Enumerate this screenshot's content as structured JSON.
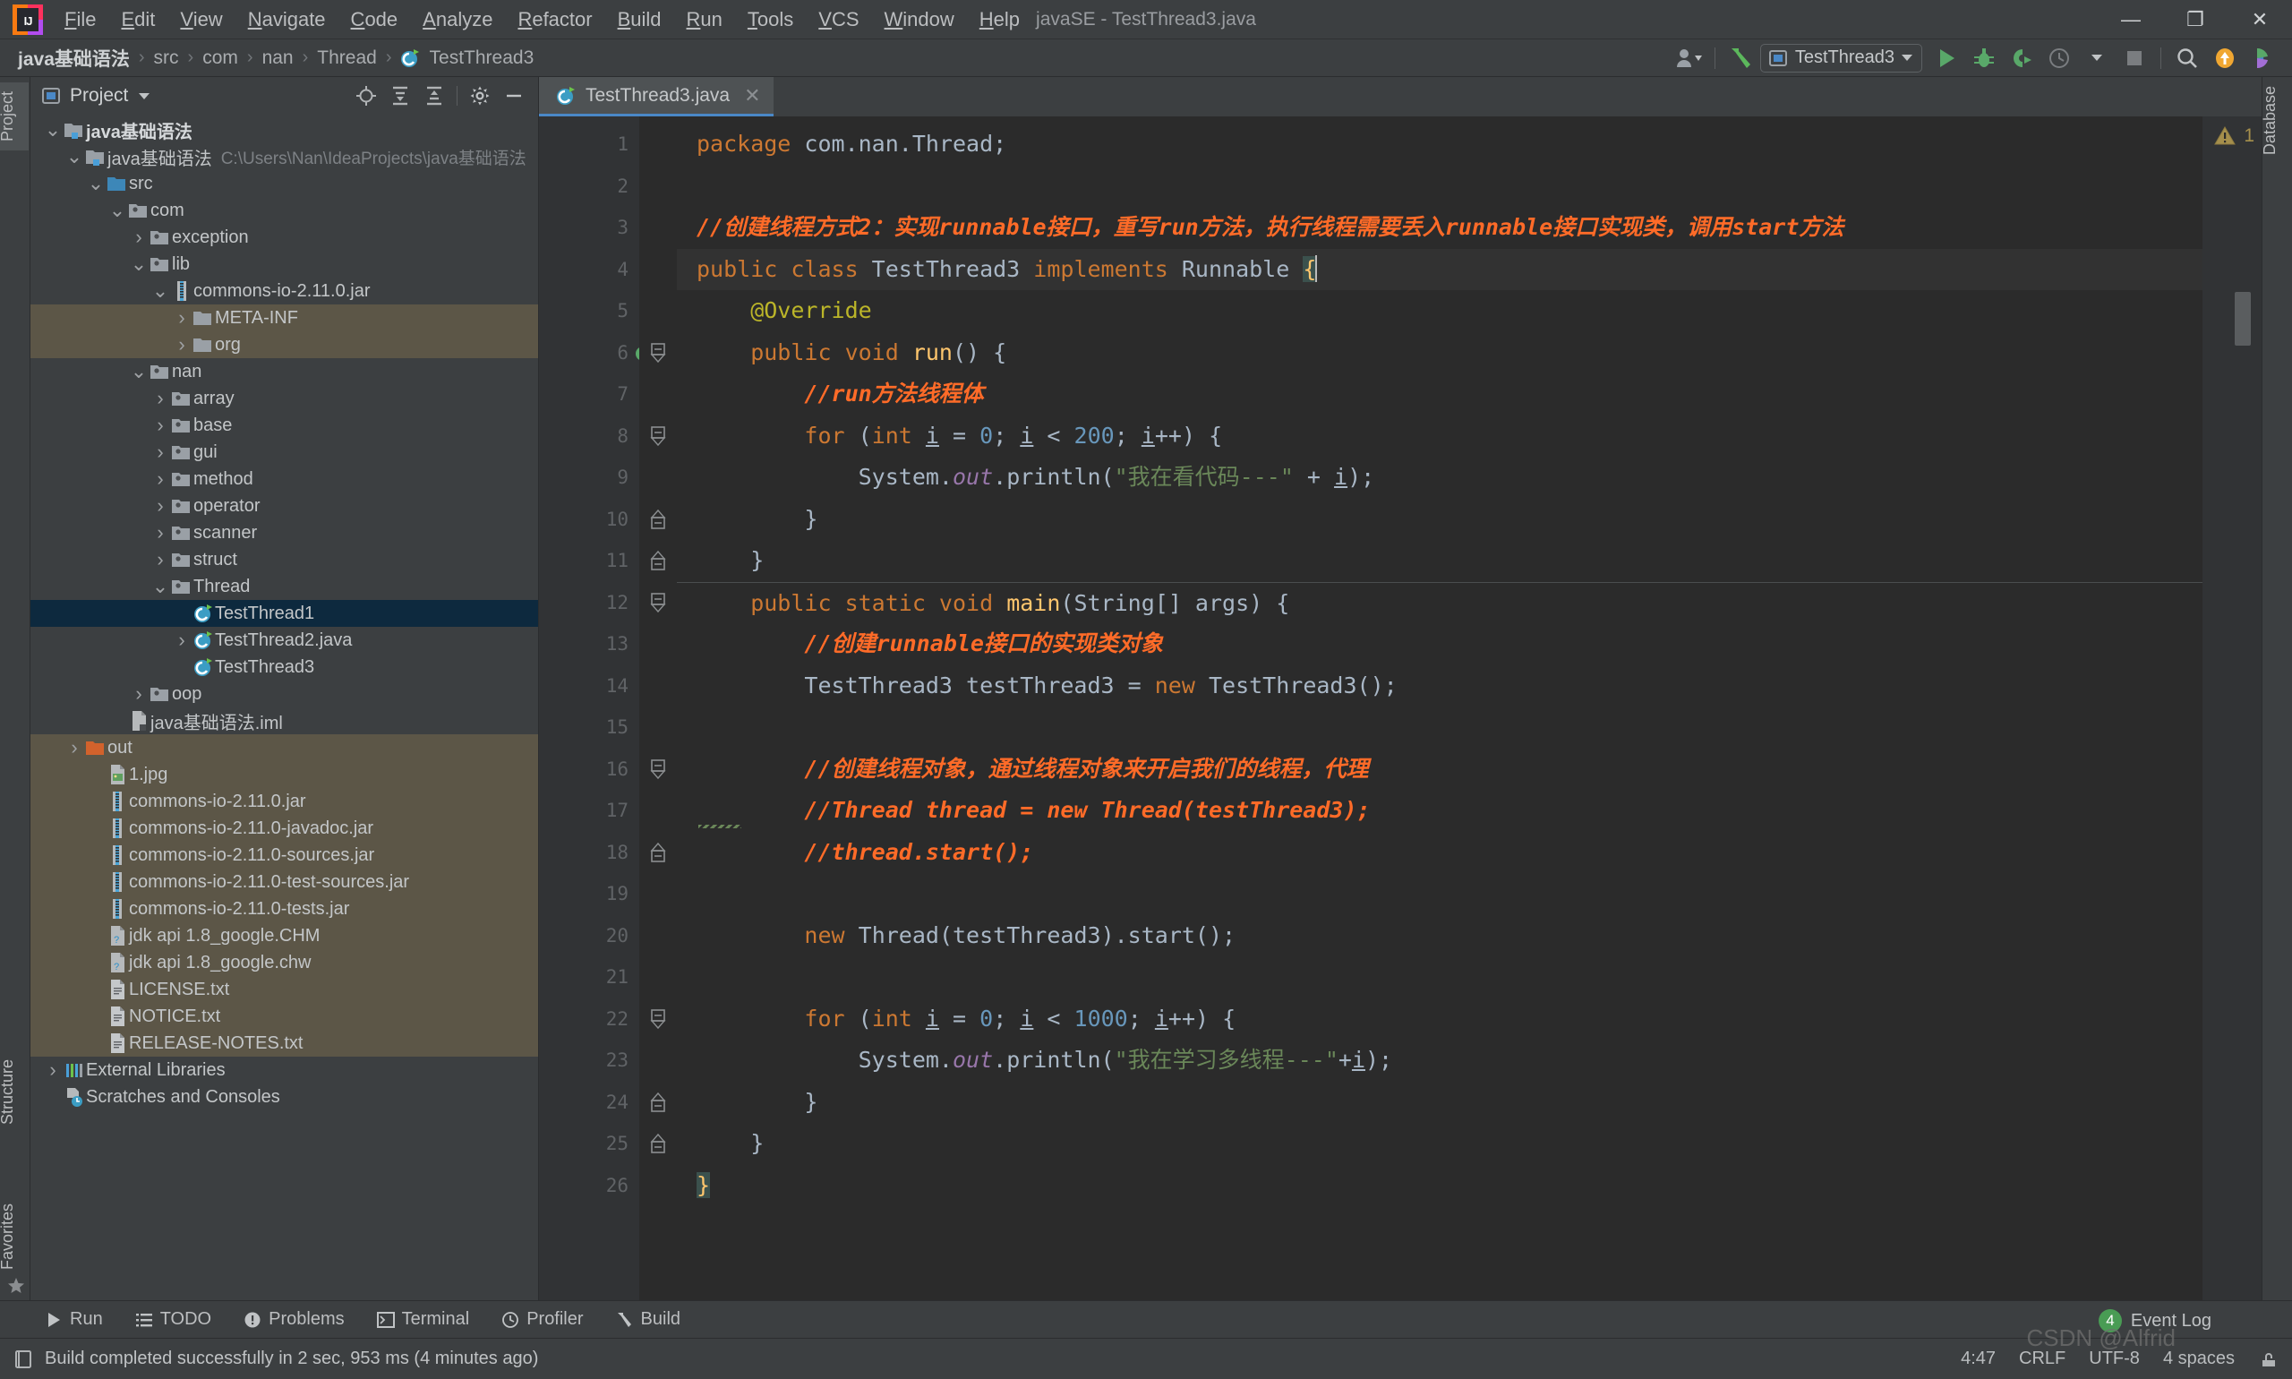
{
  "window": {
    "title": "javaSE - TestThread3.java",
    "minimize": "—",
    "maximize": "❐",
    "close": "✕"
  },
  "menubar": {
    "items": [
      "File",
      "Edit",
      "View",
      "Navigate",
      "Code",
      "Analyze",
      "Refactor",
      "Build",
      "Run",
      "Tools",
      "VCS",
      "Window",
      "Help"
    ]
  },
  "navbar": {
    "breadcrumbs": [
      "java基础语法",
      "src",
      "com",
      "nan",
      "Thread",
      "TestThread3"
    ],
    "separator": "›",
    "run_config": "TestThread3",
    "icons": [
      "user-profile-icon",
      "build-hammer-icon",
      "run-icon",
      "debug-icon",
      "run-coverage-icon",
      "profiler-icon",
      "stop-icon",
      "search-everywhere-icon",
      "updates-icon",
      "ide-helper-icon"
    ]
  },
  "sidebar_left": {
    "top_label": "Project",
    "bottom_labels": [
      "Structure",
      "Favorites"
    ]
  },
  "sidebar_right": {
    "label": "Database"
  },
  "project_panel": {
    "title": "Project",
    "toolbar_icons": [
      "locate-icon",
      "expand-all-icon",
      "collapse-all-icon",
      "settings-gear-icon",
      "hide-icon"
    ],
    "tree": [
      {
        "label": "java基础语法",
        "indent": 0,
        "arrow": "down",
        "icon": "module-folder",
        "bold": true,
        "state": "none"
      },
      {
        "label": "java基础语法",
        "sub": "C:\\Users\\Nan\\IdeaProjects\\java基础语法",
        "indent": 1,
        "arrow": "down",
        "icon": "module-folder",
        "state": "none"
      },
      {
        "label": "src",
        "indent": 2,
        "arrow": "down",
        "icon": "source-folder",
        "state": "none"
      },
      {
        "label": "com",
        "indent": 3,
        "arrow": "down",
        "icon": "package",
        "state": "none"
      },
      {
        "label": "exception",
        "indent": 4,
        "arrow": "right",
        "icon": "package",
        "state": "none"
      },
      {
        "label": "lib",
        "indent": 4,
        "arrow": "down",
        "icon": "package",
        "state": "none"
      },
      {
        "label": "commons-io-2.11.0.jar",
        "indent": 5,
        "arrow": "down",
        "icon": "jar",
        "state": "none"
      },
      {
        "label": "META-INF",
        "indent": 6,
        "arrow": "right",
        "icon": "folder",
        "state": "highlight"
      },
      {
        "label": "org",
        "indent": 6,
        "arrow": "right",
        "icon": "folder",
        "state": "highlight"
      },
      {
        "label": "nan",
        "indent": 4,
        "arrow": "down",
        "icon": "package",
        "state": "none"
      },
      {
        "label": "array",
        "indent": 5,
        "arrow": "right",
        "icon": "package",
        "state": "none"
      },
      {
        "label": "base",
        "indent": 5,
        "arrow": "right",
        "icon": "package",
        "state": "none"
      },
      {
        "label": "gui",
        "indent": 5,
        "arrow": "right",
        "icon": "package",
        "state": "none"
      },
      {
        "label": "method",
        "indent": 5,
        "arrow": "right",
        "icon": "package",
        "state": "none"
      },
      {
        "label": "operator",
        "indent": 5,
        "arrow": "right",
        "icon": "package",
        "state": "none"
      },
      {
        "label": "scanner",
        "indent": 5,
        "arrow": "right",
        "icon": "package",
        "state": "none"
      },
      {
        "label": "struct",
        "indent": 5,
        "arrow": "right",
        "icon": "package",
        "state": "none"
      },
      {
        "label": "Thread",
        "indent": 5,
        "arrow": "down",
        "icon": "package",
        "state": "none"
      },
      {
        "label": "TestThread1",
        "indent": 6,
        "arrow": "none",
        "icon": "java-class",
        "state": "selected"
      },
      {
        "label": "TestThread2.java",
        "indent": 6,
        "arrow": "right",
        "icon": "java-class",
        "state": "none"
      },
      {
        "label": "TestThread3",
        "indent": 6,
        "arrow": "none",
        "icon": "java-class",
        "state": "none"
      },
      {
        "label": "oop",
        "indent": 4,
        "arrow": "right",
        "icon": "package",
        "state": "none"
      },
      {
        "label": "java基础语法.iml",
        "indent": 3,
        "arrow": "none",
        "icon": "iml",
        "state": "none"
      },
      {
        "label": "out",
        "indent": 1,
        "arrow": "right",
        "icon": "excluded-folder",
        "state": "highlight"
      },
      {
        "label": "1.jpg",
        "indent": 2,
        "arrow": "none",
        "icon": "image",
        "state": "highlight"
      },
      {
        "label": "commons-io-2.11.0.jar",
        "indent": 2,
        "arrow": "none",
        "icon": "jar",
        "state": "highlight"
      },
      {
        "label": "commons-io-2.11.0-javadoc.jar",
        "indent": 2,
        "arrow": "none",
        "icon": "jar",
        "state": "highlight"
      },
      {
        "label": "commons-io-2.11.0-sources.jar",
        "indent": 2,
        "arrow": "none",
        "icon": "jar",
        "state": "highlight"
      },
      {
        "label": "commons-io-2.11.0-test-sources.jar",
        "indent": 2,
        "arrow": "none",
        "icon": "jar",
        "state": "highlight"
      },
      {
        "label": "commons-io-2.11.0-tests.jar",
        "indent": 2,
        "arrow": "none",
        "icon": "jar",
        "state": "highlight"
      },
      {
        "label": "jdk api 1.8_google.CHM",
        "indent": 2,
        "arrow": "none",
        "icon": "unknown-file",
        "state": "highlight"
      },
      {
        "label": "jdk api 1.8_google.chw",
        "indent": 2,
        "arrow": "none",
        "icon": "unknown-file",
        "state": "highlight"
      },
      {
        "label": "LICENSE.txt",
        "indent": 2,
        "arrow": "none",
        "icon": "text-file",
        "state": "highlight"
      },
      {
        "label": "NOTICE.txt",
        "indent": 2,
        "arrow": "none",
        "icon": "text-file",
        "state": "highlight"
      },
      {
        "label": "RELEASE-NOTES.txt",
        "indent": 2,
        "arrow": "none",
        "icon": "text-file",
        "state": "highlight"
      },
      {
        "label": "External Libraries",
        "indent": 0,
        "arrow": "right",
        "icon": "libraries",
        "state": "none"
      },
      {
        "label": "Scratches and Consoles",
        "indent": 0,
        "arrow": "none",
        "icon": "scratches",
        "state": "none"
      }
    ]
  },
  "editor": {
    "tab": {
      "label": "TestThread3.java",
      "icon": "java-class-icon",
      "close": "✕"
    },
    "warning_count": "1",
    "warning_icon": "warning-triangle-icon",
    "nav_up": "⌃",
    "nav_down": "⌄",
    "line_count": 26,
    "lines": [
      {
        "n": 1,
        "tokens": [
          {
            "t": "package ",
            "c": "k"
          },
          {
            "t": "com.nan.Thread;",
            "c": "id"
          }
        ]
      },
      {
        "n": 2,
        "tokens": []
      },
      {
        "n": 3,
        "tokens": [
          {
            "t": "//创建线程方式2：实现runnable接口，重写run方法，执行线程需要丢入runnable接口实现类，调用start方法",
            "c": "cm"
          }
        ]
      },
      {
        "n": 4,
        "run_marker": true,
        "current": true,
        "tokens": [
          {
            "t": "public class ",
            "c": "k"
          },
          {
            "t": "TestThread3 ",
            "c": "id"
          },
          {
            "t": "implements ",
            "c": "k"
          },
          {
            "t": "Runnable ",
            "c": "id"
          },
          {
            "t": "{",
            "c": "brace"
          },
          {
            "t": "",
            "c": "caret"
          }
        ]
      },
      {
        "n": 5,
        "tokens": [
          {
            "t": "    @Override",
            "c": "an"
          }
        ]
      },
      {
        "n": 6,
        "override_marker": true,
        "fold": "start",
        "tokens": [
          {
            "t": "    public void ",
            "c": "k"
          },
          {
            "t": "run",
            "c": "fn"
          },
          {
            "t": "() {",
            "c": "id"
          }
        ]
      },
      {
        "n": 7,
        "tokens": [
          {
            "t": "        //run方法线程体",
            "c": "cm"
          }
        ]
      },
      {
        "n": 8,
        "fold": "start",
        "tokens": [
          {
            "t": "        ",
            "c": "id"
          },
          {
            "t": "for ",
            "c": "k"
          },
          {
            "t": "(",
            "c": "id"
          },
          {
            "t": "int ",
            "c": "k"
          },
          {
            "t": "i",
            "c": "vu"
          },
          {
            "t": " = ",
            "c": "id"
          },
          {
            "t": "0",
            "c": "num"
          },
          {
            "t": "; ",
            "c": "id"
          },
          {
            "t": "i",
            "c": "vu"
          },
          {
            "t": " < ",
            "c": "id"
          },
          {
            "t": "200",
            "c": "num"
          },
          {
            "t": "; ",
            "c": "id"
          },
          {
            "t": "i",
            "c": "vu"
          },
          {
            "t": "++) {",
            "c": "id"
          }
        ]
      },
      {
        "n": 9,
        "tokens": [
          {
            "t": "            System.",
            "c": "id"
          },
          {
            "t": "out",
            "c": "fl"
          },
          {
            "t": ".println(",
            "c": "id"
          },
          {
            "t": "\"我在看代码---\"",
            "c": "st"
          },
          {
            "t": " + ",
            "c": "id"
          },
          {
            "t": "i",
            "c": "vu"
          },
          {
            "t": ");",
            "c": "id"
          }
        ]
      },
      {
        "n": 10,
        "fold": "end",
        "tokens": [
          {
            "t": "        }",
            "c": "id"
          }
        ]
      },
      {
        "n": 11,
        "fold": "end",
        "tokens": [
          {
            "t": "    }",
            "c": "id"
          }
        ]
      },
      {
        "n": 12,
        "run_marker": true,
        "fold": "start",
        "separator": true,
        "tokens": [
          {
            "t": "    public static void ",
            "c": "k"
          },
          {
            "t": "main",
            "c": "fn"
          },
          {
            "t": "(String[] args) {",
            "c": "id"
          }
        ]
      },
      {
        "n": 13,
        "tokens": [
          {
            "t": "        //创建runnable接口的实现类对象",
            "c": "cm"
          }
        ]
      },
      {
        "n": 14,
        "tokens": [
          {
            "t": "        TestThread3 testThread3 = ",
            "c": "id"
          },
          {
            "t": "new ",
            "c": "k"
          },
          {
            "t": "TestThread3();",
            "c": "id"
          }
        ]
      },
      {
        "n": 15,
        "tokens": []
      },
      {
        "n": 16,
        "fold": "start",
        "tokens": [
          {
            "t": "        //创建线程对象，通过线程对象来开启我们的线程，代理",
            "c": "cm"
          }
        ]
      },
      {
        "n": 17,
        "tokens": [
          {
            "t": "        //Thread thread = new Thread(testThread3);",
            "c": "cm"
          }
        ]
      },
      {
        "n": 18,
        "fold": "end",
        "tokens": [
          {
            "t": "        //thread.start();",
            "c": "cm"
          }
        ]
      },
      {
        "n": 19,
        "tokens": []
      },
      {
        "n": 20,
        "tokens": [
          {
            "t": "        ",
            "c": "id"
          },
          {
            "t": "new ",
            "c": "k"
          },
          {
            "t": "Thread(testThread3).start();",
            "c": "id"
          }
        ]
      },
      {
        "n": 21,
        "tokens": []
      },
      {
        "n": 22,
        "fold": "start",
        "tokens": [
          {
            "t": "        ",
            "c": "id"
          },
          {
            "t": "for ",
            "c": "k"
          },
          {
            "t": "(",
            "c": "id"
          },
          {
            "t": "int ",
            "c": "k"
          },
          {
            "t": "i",
            "c": "vu"
          },
          {
            "t": " = ",
            "c": "id"
          },
          {
            "t": "0",
            "c": "num"
          },
          {
            "t": "; ",
            "c": "id"
          },
          {
            "t": "i",
            "c": "vu"
          },
          {
            "t": " < ",
            "c": "id"
          },
          {
            "t": "1000",
            "c": "num"
          },
          {
            "t": "; ",
            "c": "id"
          },
          {
            "t": "i",
            "c": "vu"
          },
          {
            "t": "++) {",
            "c": "id"
          }
        ]
      },
      {
        "n": 23,
        "tokens": [
          {
            "t": "            System.",
            "c": "id"
          },
          {
            "t": "out",
            "c": "fl"
          },
          {
            "t": ".println(",
            "c": "id"
          },
          {
            "t": "\"我在学习多线程---\"",
            "c": "st"
          },
          {
            "t": "+",
            "c": "id"
          },
          {
            "t": "i",
            "c": "vu"
          },
          {
            "t": ");",
            "c": "id"
          }
        ]
      },
      {
        "n": 24,
        "fold": "end",
        "tokens": [
          {
            "t": "        }",
            "c": "id"
          }
        ]
      },
      {
        "n": 25,
        "fold": "end",
        "tokens": [
          {
            "t": "    }",
            "c": "id"
          }
        ]
      },
      {
        "n": 26,
        "tokens": [
          {
            "t": "}",
            "c": "brace"
          }
        ]
      }
    ]
  },
  "tool_windows": [
    {
      "label": "Run",
      "icon": "run-icon"
    },
    {
      "label": "TODO",
      "icon": "todo-icon"
    },
    {
      "label": "Problems",
      "icon": "problems-icon"
    },
    {
      "label": "Terminal",
      "icon": "terminal-icon"
    },
    {
      "label": "Profiler",
      "icon": "profiler-icon"
    },
    {
      "label": "Build",
      "icon": "build-hammer-icon"
    }
  ],
  "status_bar": {
    "message": "Build completed successfully in 2 sec, 953 ms (4 minutes ago)",
    "message_icon": "build-status-icon",
    "event_log": "Event Log",
    "event_count": "4",
    "caret_position": "4:47",
    "line_separator": "CRLF",
    "encoding": "UTF-8",
    "indent": "4 spaces",
    "lock_icon": "read-only-icon",
    "watermark": "CSDN @Alfrid"
  },
  "colors": {
    "accent": "#4a88c7",
    "selection": "#0d293e",
    "highlight": "#5c5647",
    "comment": "#ff6b28",
    "keyword": "#cc7832",
    "string": "#6a8759",
    "number": "#6897bb",
    "annotation": "#bbb529",
    "method": "#ffc66d",
    "field": "#9876aa",
    "run_green": "#5cb85c",
    "panel_bg": "#3c3f41",
    "editor_bg": "#2b2b2b",
    "gutter_bg": "#313335"
  }
}
